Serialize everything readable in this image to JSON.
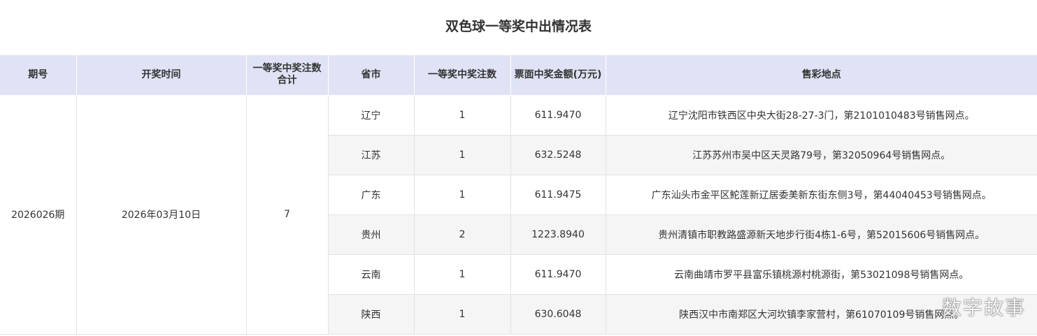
{
  "title": "双色球一等奖中出情况表",
  "columns": [
    "期号",
    "开奖时间",
    "一等奖中奖注数合计",
    "省市",
    "一等奖中奖注数",
    "票面中奖金额(万元)",
    "售彩地点"
  ],
  "issue": "2026026期",
  "draw_date": "2026年03月10日",
  "total_winners": "7",
  "rows": [
    {
      "province": "辽宁",
      "count": "1",
      "amount": "611.9470",
      "location": "辽宁沈阳市铁西区中央大街28-27-3门，第2101010483号销售网点。"
    },
    {
      "province": "江苏",
      "count": "1",
      "amount": "632.5248",
      "location": "江苏苏州市吴中区天灵路79号，第32050964号销售网点。"
    },
    {
      "province": "广东",
      "count": "1",
      "amount": "611.9475",
      "location": "广东汕头市金平区鮀莲新辽居委美新东街东侧3号，第44040453号销售网点。"
    },
    {
      "province": "贵州",
      "count": "2",
      "amount": "1223.8940",
      "location": "贵州清镇市职教路盛源新天地步行街4栋1-6号，第52015606号销售网点。"
    },
    {
      "province": "云南",
      "count": "1",
      "amount": "611.9470",
      "location": "云南曲靖市罗平县富乐镇桃源村桃源街，第53021098号销售网点。"
    },
    {
      "province": "陕西",
      "count": "1",
      "amount": "630.6048",
      "location": "陕西汉中市南郑区大河坎镇李家营村，第61070109号销售网点。"
    }
  ],
  "watermark": "数字故事"
}
